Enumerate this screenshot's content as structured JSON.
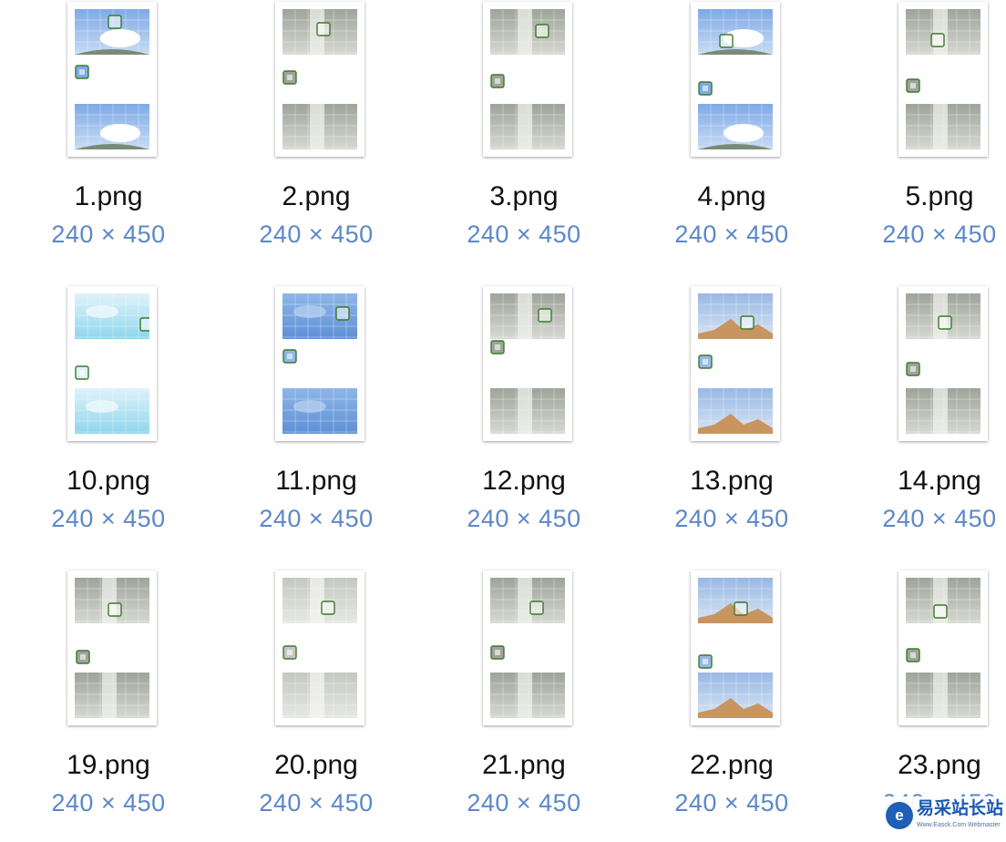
{
  "files": [
    {
      "name": "1.png",
      "dimensions": "240 × 450",
      "theme": "sky-cloud-bird"
    },
    {
      "name": "2.png",
      "dimensions": "240 × 450",
      "theme": "waterfall"
    },
    {
      "name": "3.png",
      "dimensions": "240 × 450",
      "theme": "waterfall"
    },
    {
      "name": "4.png",
      "dimensions": "240 × 450",
      "theme": "sky-cloud-bird"
    },
    {
      "name": "5.png",
      "dimensions": "240 × 450",
      "theme": "waterfall"
    },
    {
      "name": "10.png",
      "dimensions": "240 × 450",
      "theme": "cyan-sky"
    },
    {
      "name": "11.png",
      "dimensions": "240 × 450",
      "theme": "blue-sky"
    },
    {
      "name": "12.png",
      "dimensions": "240 × 450",
      "theme": "waterfall"
    },
    {
      "name": "13.png",
      "dimensions": "240 × 450",
      "theme": "pyramid"
    },
    {
      "name": "14.png",
      "dimensions": "240 × 450",
      "theme": "waterfall"
    },
    {
      "name": "19.png",
      "dimensions": "240 × 450",
      "theme": "waterfall"
    },
    {
      "name": "20.png",
      "dimensions": "240 × 450",
      "theme": "waterfall-pale"
    },
    {
      "name": "21.png",
      "dimensions": "240 × 450",
      "theme": "waterfall"
    },
    {
      "name": "22.png",
      "dimensions": "240 × 450",
      "theme": "pyramid"
    },
    {
      "name": "23.png",
      "dimensions": "240 × 450",
      "theme": "waterfall"
    }
  ],
  "colors": {
    "filename": "#111111",
    "dimensions": "#5c87c8",
    "background": "#ffffff",
    "piece_border": "#3a7a2a"
  },
  "watermark": {
    "text": "易采站长站",
    "subtext": "Www.Easck.Com  Webmaster",
    "logo_icon": "e-logo-icon"
  }
}
